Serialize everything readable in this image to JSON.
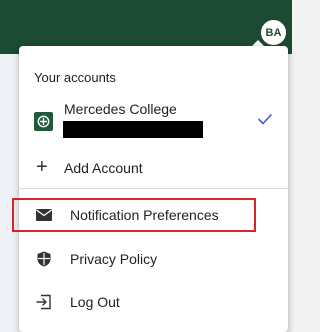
{
  "header": {
    "avatar_initials": "BA",
    "bar_color": "#1d4a33"
  },
  "menu": {
    "section_title": "Your accounts",
    "account": {
      "name": "Mercedes College",
      "selected": true,
      "logo_icon": "college-crest-icon",
      "check_icon": "checkmark-icon",
      "check_color": "#3d5bd9"
    },
    "add_account_label": "Add Account",
    "add_icon": "plus-icon",
    "items": [
      {
        "label": "Notification Preferences",
        "icon": "envelope-icon",
        "highlighted": true
      },
      {
        "label": "Privacy Policy",
        "icon": "shield-icon"
      },
      {
        "label": "Log Out",
        "icon": "logout-icon"
      }
    ],
    "highlight_color": "#d8232a"
  }
}
